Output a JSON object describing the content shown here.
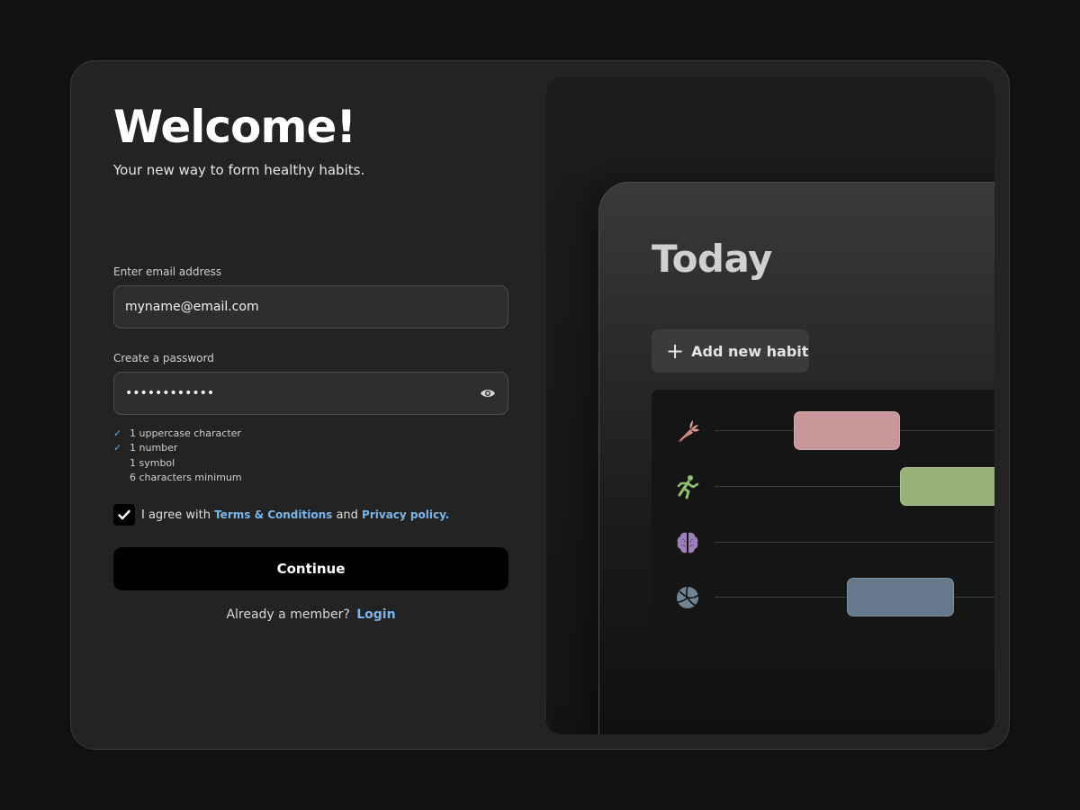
{
  "welcome": {
    "title": "Welcome!",
    "subtitle": "Your new way to form healthy habits."
  },
  "email": {
    "label": "Enter email address",
    "value": "myname@email.com"
  },
  "password": {
    "label": "Create a password",
    "value": "••••••••••••",
    "toggle_icon": "eye-icon"
  },
  "password_rules": [
    {
      "text": "1 uppercase character",
      "met": true
    },
    {
      "text": "1 number",
      "met": true
    },
    {
      "text": "1 symbol",
      "met": false
    },
    {
      "text": "6 characters minimum",
      "met": false
    }
  ],
  "agreement": {
    "checked": true,
    "prefix": "I agree with",
    "terms_link": "Terms & Conditions",
    "conjunction": "and",
    "privacy_link": "Privacy policy."
  },
  "continue_label": "Continue",
  "login_prompt": {
    "text": "Already a member?",
    "link": "Login"
  },
  "preview": {
    "heading": "Today",
    "add_button_label": "Add new habit",
    "habits": [
      {
        "icon": "carrot-icon",
        "color": "#c79799",
        "icon_color": "#e39b8f",
        "bar_start": 0.238,
        "bar_end": 0.558
      },
      {
        "icon": "running-icon",
        "color": "#97b37a",
        "icon_color": "#8fbf6f",
        "bar_start": 0.558,
        "bar_end": 1.0
      },
      {
        "icon": "brain-icon",
        "color": null,
        "icon_color": "#9d7fbd",
        "bar_start": null,
        "bar_end": null
      },
      {
        "icon": "volleyball-icon",
        "color": "#65798a",
        "icon_color": "#6f8494",
        "bar_start": 0.398,
        "bar_end": 0.718
      }
    ]
  },
  "colors": {
    "page_background": "#111111",
    "card_background": "#232323",
    "accent_link": "#7ab6ec",
    "check_tick": "#6aa6e0"
  }
}
